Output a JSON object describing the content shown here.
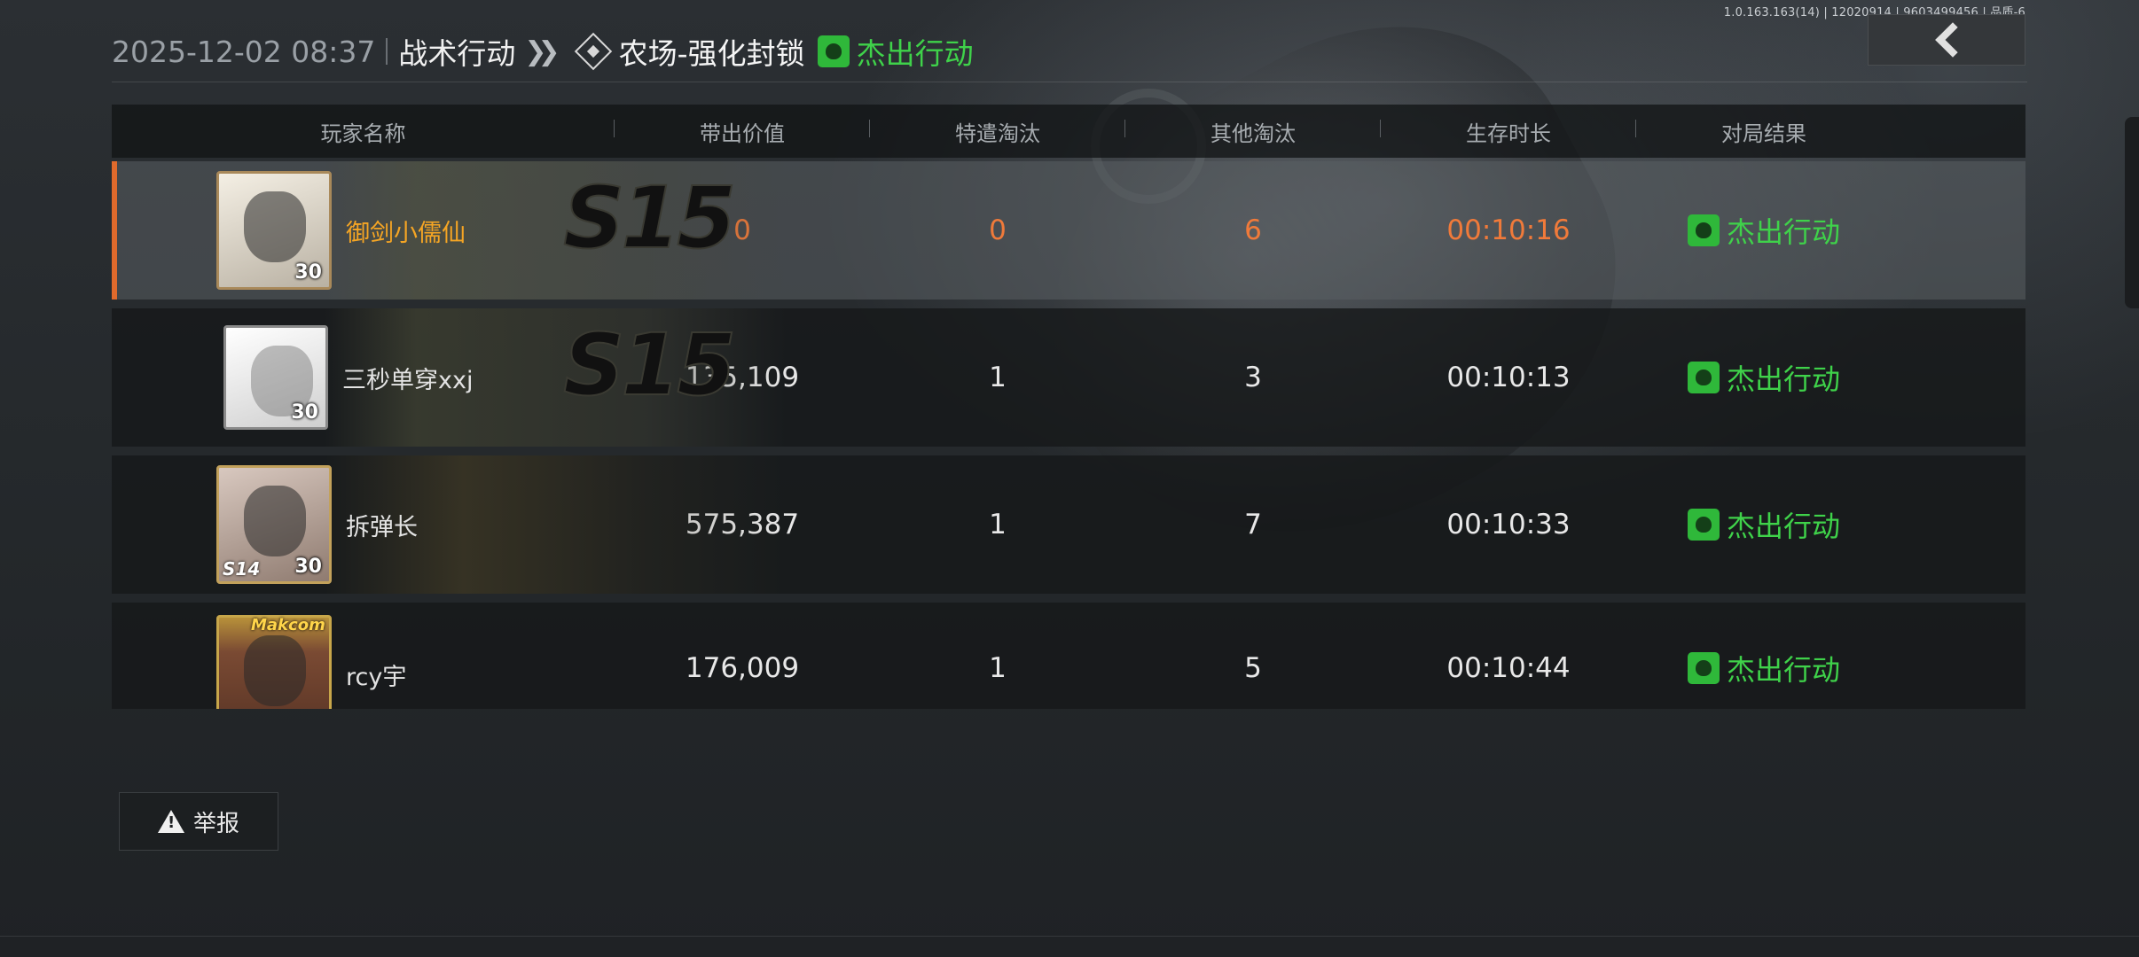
{
  "version": "1.0.163.163(14) | 12020914 | 9603499456 | 品质-6",
  "header": {
    "datetime": "2025-12-02 08:37",
    "mode": "战术行动",
    "map": "农场-强化封锁",
    "result": "杰出行动",
    "icons": {
      "mode_separator": "double-chevron-icon",
      "map": "diamond-target-icon",
      "result": "flame-icon",
      "back": "chevron-left-icon"
    }
  },
  "table": {
    "columns": [
      "玩家名称",
      "带出价值",
      "特遣淘汰",
      "其他淘汰",
      "生存时长",
      "对局结果"
    ],
    "rows": [
      {
        "name": "御剑小儒仙",
        "level": "30",
        "season_banner": "S15",
        "value": "0",
        "special_kills": "0",
        "other_kills": "6",
        "survival": "00:10:16",
        "result": "杰出行动",
        "highlight": true
      },
      {
        "name": "三秒单穿xxj",
        "level": "30",
        "season_banner": "S15",
        "value": "135,109",
        "special_kills": "1",
        "other_kills": "3",
        "survival": "00:10:13",
        "result": "杰出行动",
        "highlight": false
      },
      {
        "name": "拆弹长",
        "level": "30",
        "avatar_tag": "S14",
        "value": "575,387",
        "special_kills": "1",
        "other_kills": "7",
        "survival": "00:10:33",
        "result": "杰出行动",
        "highlight": false
      },
      {
        "name": "rcy宇",
        "level": "",
        "avatar_tag": "Makcom",
        "value": "176,009",
        "special_kills": "1",
        "other_kills": "5",
        "survival": "00:10:44",
        "result": "杰出行动",
        "highlight": false
      }
    ]
  },
  "report": {
    "label": "举报",
    "icon": "warning-icon"
  },
  "colors": {
    "accent_orange": "#f07a3a",
    "success_green": "#3fd24a",
    "name_highlight": "#f5a524"
  }
}
